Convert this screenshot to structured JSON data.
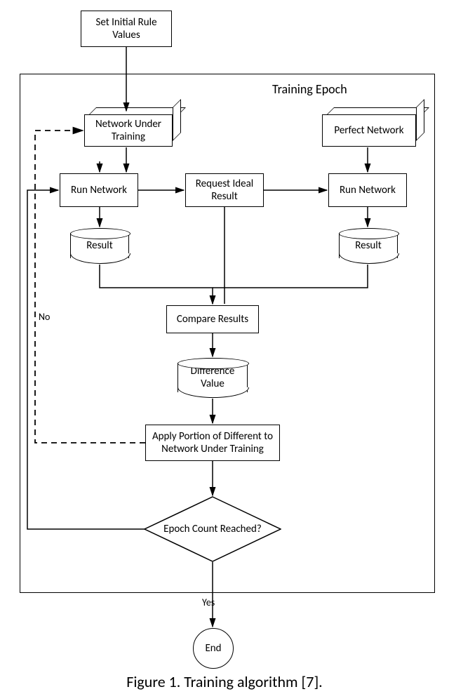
{
  "nodes": {
    "set_initial": "Set Initial Rule Values",
    "epoch_label": "Training Epoch",
    "network_under_training": "Network Under Training",
    "perfect_network": "Perfect Network",
    "run_network_left": "Run Network",
    "request_ideal": "Request Ideal Result",
    "run_network_right": "Run Network",
    "result_left": "Result",
    "result_right": "Result",
    "compare_results": "Compare Results",
    "difference_value": "Difference Value",
    "apply_portion": "Apply Portion of Different to Network Under Training",
    "epoch_count": "Epoch Count Reached?",
    "end": "End"
  },
  "edge_labels": {
    "no": "No",
    "yes": "Yes"
  },
  "caption": "Figure 1. Training algorithm [7]."
}
